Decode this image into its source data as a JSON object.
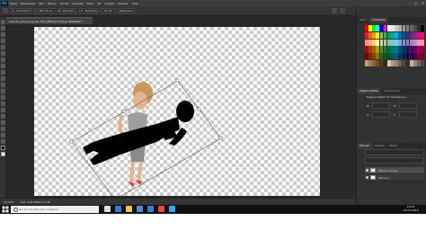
{
  "app": {
    "logo": "Ps",
    "menu": [
      "Datei",
      "Bearbeiten",
      "Bild",
      "Ebene",
      "Schrift",
      "Auswahl",
      "Filter",
      "3D",
      "Ansicht",
      "Fenster",
      "Hilfe"
    ],
    "window_controls": [
      "–",
      "□",
      "✕"
    ]
  },
  "options_bar": {
    "fields": [
      "X: 315,50 Px",
      "Y: 385,50 Px",
      "B: 100,00%",
      "H: 100,00%",
      "-32,78 °",
      "Bikubisch"
    ],
    "confirm_icon": "check-icon",
    "cancel_icon": "cancel-icon"
  },
  "document": {
    "tab_title": "woman_shoes.png bei 33% (Ebene 0 Kopie, RGB/8#) *"
  },
  "status_bar": {
    "zoom": "33,33%",
    "doc_size": "Dok: 4,86 MB/9,72 MB"
  },
  "right_panels": {
    "top_tabs": [
      "Farbe",
      "Farbfelder"
    ],
    "swatch_colors": [
      "#ff0000",
      "#ffff00",
      "#00ff00",
      "#00ffff",
      "#0000ff",
      "#ff00ff",
      "#ffffff",
      "#e6e6e6",
      "#cccccc",
      "#b3b3b3",
      "#999999",
      "#808080",
      "#666666",
      "#4d4d4d",
      "#333333",
      "#000000",
      "#ed1c24",
      "#f26522",
      "#f7941d",
      "#fff200",
      "#8dc63f",
      "#39b54a",
      "#00a651",
      "#00a99d",
      "#00aeef",
      "#0072bc",
      "#0054a6",
      "#2e3192",
      "#662d91",
      "#92278f",
      "#ec008c",
      "#ed145b",
      "#f69679",
      "#f9ad81",
      "#fdc689",
      "#fff799",
      "#c4df9b",
      "#a3d39c",
      "#82ca9c",
      "#7accc8",
      "#6dcff6",
      "#7da7d9",
      "#8393ca",
      "#8781bd",
      "#a187be",
      "#bc8cbf",
      "#f49ac2",
      "#f5989d",
      "#9e0b0f",
      "#a0410d",
      "#a36209",
      "#aba000",
      "#598527",
      "#197b30",
      "#007236",
      "#00746b",
      "#0076a3",
      "#004a80",
      "#003471",
      "#1b1464",
      "#440e62",
      "#630460",
      "#9e005d",
      "#9e0039",
      "#790000",
      "#7b2e00",
      "#7d4900",
      "#827b00",
      "#406618",
      "#005e20",
      "#005826",
      "#005952",
      "#005b7f",
      "#003663",
      "#002157",
      "#0d004c",
      "#32004b",
      "#4b0049",
      "#7b0046",
      "#7a0026",
      "#c69c6d",
      "#a67c52",
      "#8c6239",
      "#754c24",
      "#603913",
      "#3c2415",
      "#d9c7a7",
      "#b89b72",
      "#998675",
      "#736357",
      "#534741",
      "#362f2d",
      "#c7b299",
      "#998675",
      "#736357",
      "#534741"
    ],
    "mid_tabs": [
      "Eigenschaften",
      "Korrekturen"
    ],
    "properties_title": "Eigenschaften für Pixelebene",
    "prop_labels": [
      "B:",
      "H:",
      "X:",
      "Y:"
    ],
    "layers_tabs": [
      "Ebenen",
      "Kanäle",
      "Pfade"
    ],
    "layers": [
      {
        "name": "Ebene 0 Kopie",
        "selected": true
      },
      {
        "name": "Ebene 0",
        "selected": false
      }
    ]
  },
  "taskbar": {
    "search_placeholder": "Zur Suche Text hier eingeben",
    "apps": [
      {
        "icon": "task-view-icon",
        "color": "#dddddd"
      },
      {
        "icon": "edge-icon",
        "color": "#2f7fd8"
      },
      {
        "icon": "explorer-icon",
        "color": "#f4c542"
      },
      {
        "icon": "store-icon",
        "color": "#4a90d9"
      },
      {
        "icon": "mail-icon",
        "color": "#3a7bd5"
      },
      {
        "icon": "chrome-icon",
        "color": "#e24b3b"
      },
      {
        "icon": "photoshop-icon",
        "color": "#31a8ff"
      }
    ],
    "time": "10:01",
    "date": "15.03.2019"
  }
}
